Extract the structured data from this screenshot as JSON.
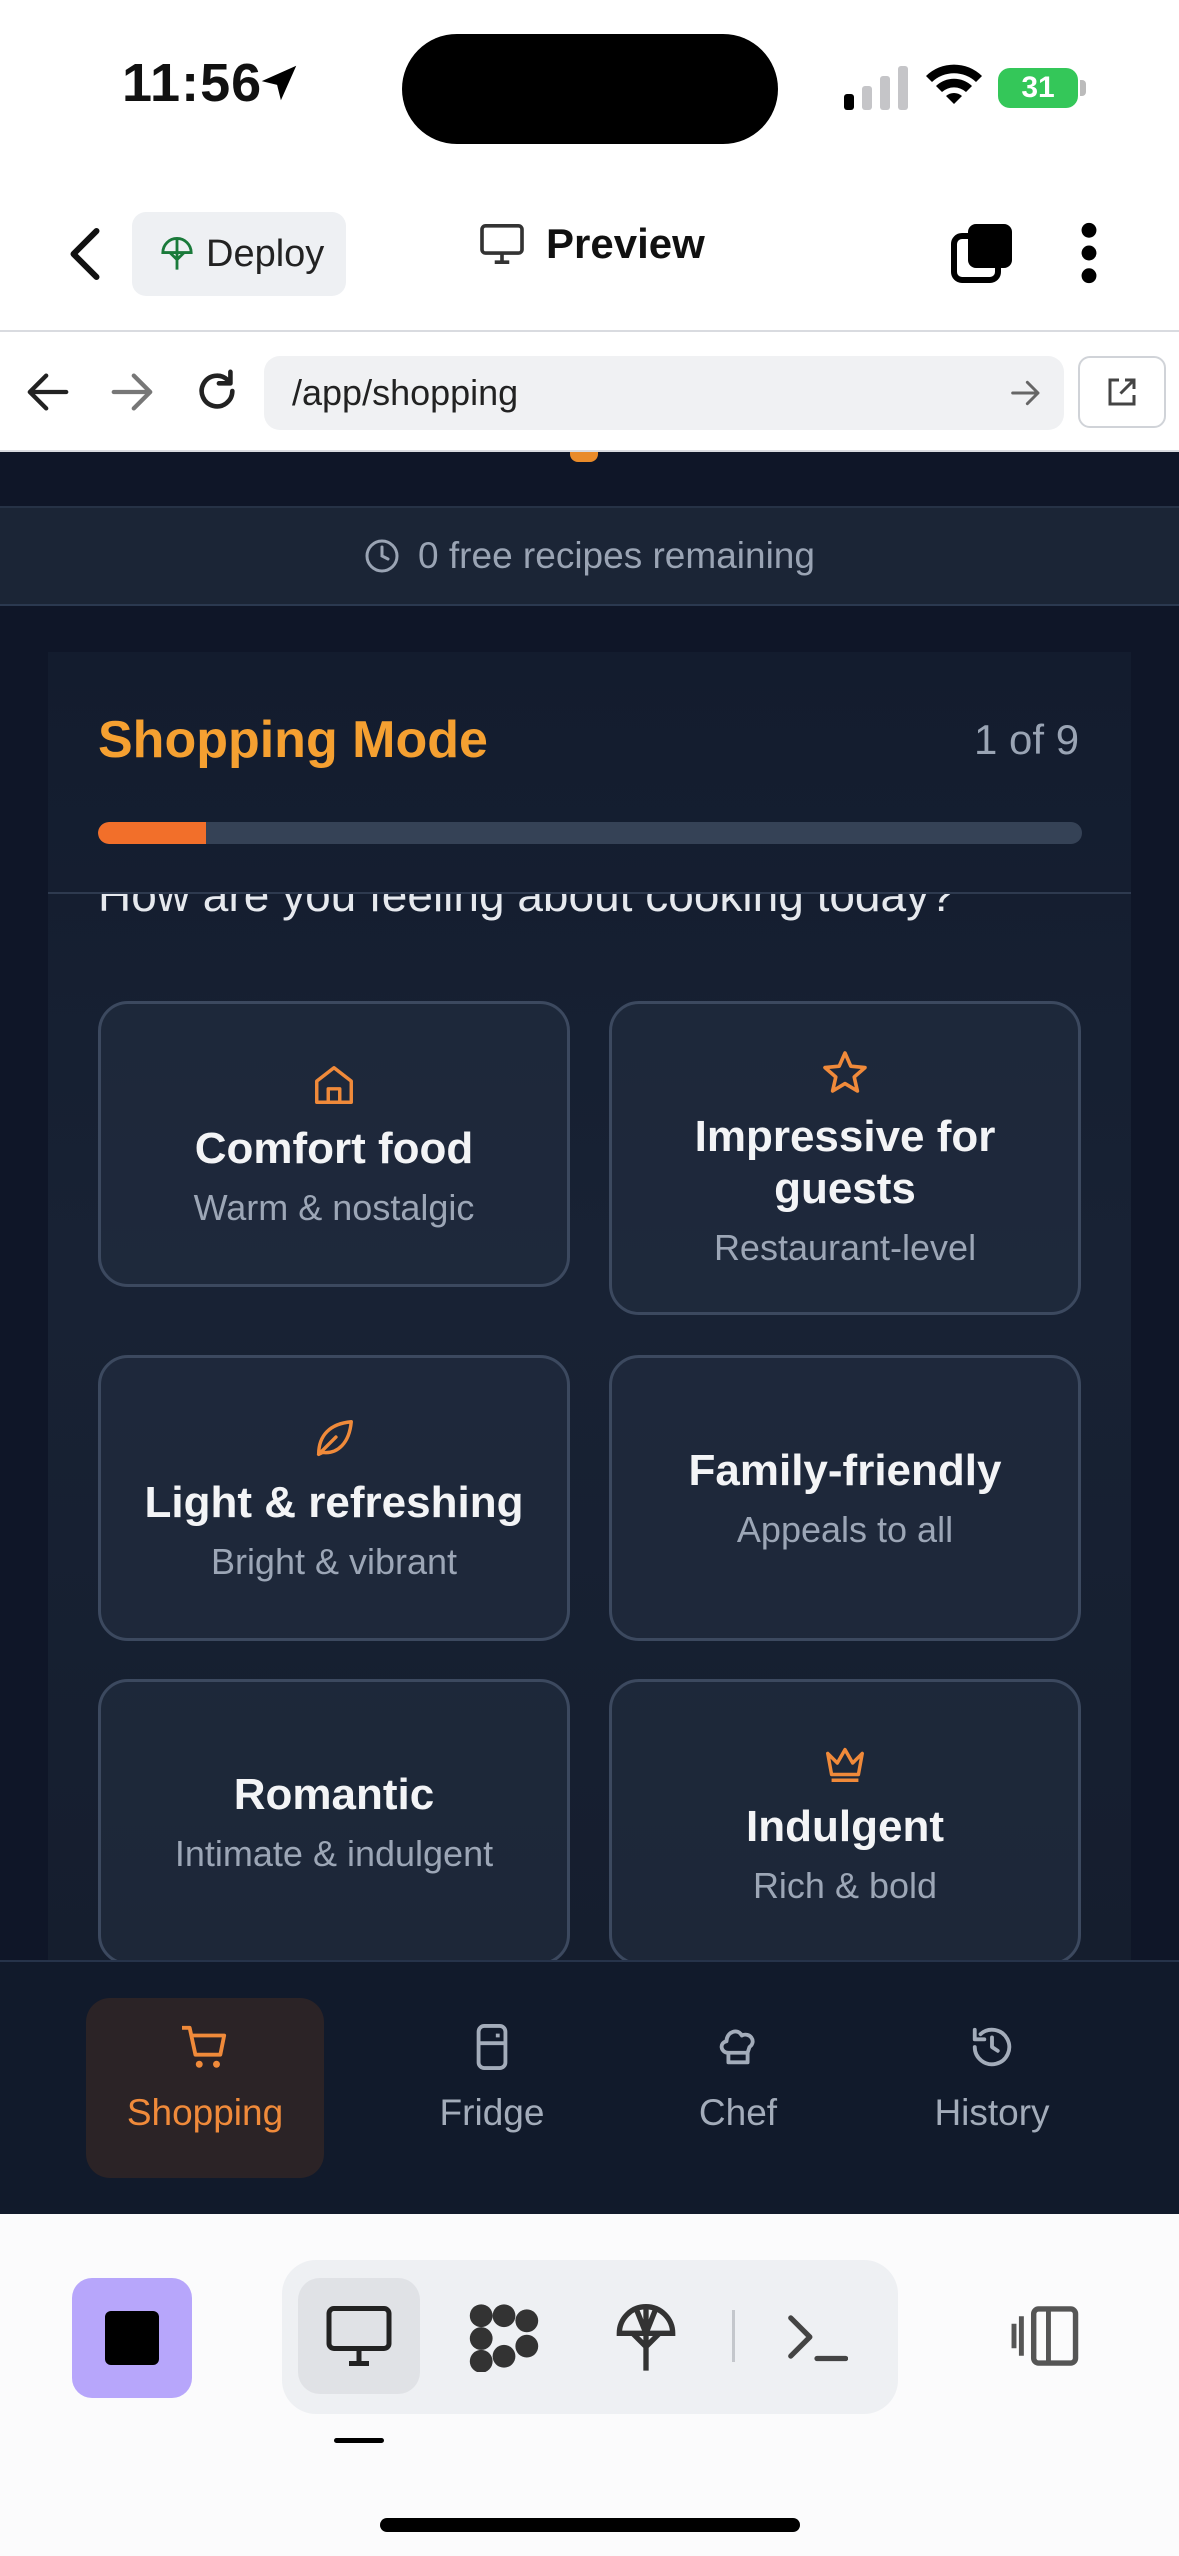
{
  "status_bar": {
    "time": "11:56",
    "battery": "31"
  },
  "header": {
    "deploy_label": "Deploy",
    "preview_label": "Preview"
  },
  "url_bar": {
    "path": "/app/shopping"
  },
  "banner": {
    "text": "0 free recipes remaining"
  },
  "shopping": {
    "title": "Shopping Mode",
    "step": "1 of 9",
    "progress": 0.11,
    "question": "How are you feeling about cooking today?",
    "options": [
      {
        "icon": "home-icon",
        "label": "Comfort food",
        "sub": "Warm & nostalgic"
      },
      {
        "icon": "star-icon",
        "label": "Impressive for guests",
        "sub": "Restaurant-level"
      },
      {
        "icon": "leaf-icon",
        "label": "Light & refreshing",
        "sub": "Bright & vibrant"
      },
      {
        "icon": "",
        "label": "Family-friendly",
        "sub": "Appeals to all"
      },
      {
        "icon": "",
        "label": "Romantic",
        "sub": "Intimate & indulgent"
      },
      {
        "icon": "crown-icon",
        "label": "Indulgent",
        "sub": "Rich & bold"
      }
    ]
  },
  "bottom_nav": {
    "items": [
      {
        "label": "Shopping",
        "icon": "cart-icon",
        "active": true
      },
      {
        "label": "Fridge",
        "icon": "fridge-icon",
        "active": false
      },
      {
        "label": "Chef",
        "icon": "chef-hat-icon",
        "active": false
      },
      {
        "label": "History",
        "icon": "history-icon",
        "active": false
      }
    ]
  },
  "colors": {
    "accent": "#f5a031",
    "progress": "#f26f2a",
    "bg": "#0f1628"
  }
}
